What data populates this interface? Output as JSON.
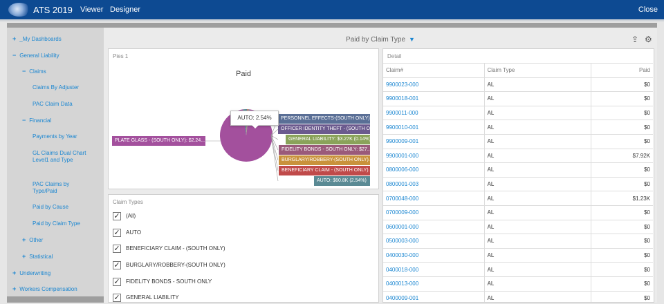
{
  "topbar": {
    "app_title": "ATS 2019",
    "nav_viewer": "Viewer",
    "nav_designer": "Designer",
    "close": "Close"
  },
  "sidebar": {
    "items": [
      {
        "sign": "+",
        "label": "_My Dashboards"
      },
      {
        "sign": "−",
        "label": "General Liability"
      },
      {
        "sign": "−",
        "label": "Claims"
      },
      {
        "sign": "",
        "label": "Claims By Adjuster"
      },
      {
        "sign": "",
        "label": "PAC Claim Data"
      },
      {
        "sign": "−",
        "label": "Financial"
      },
      {
        "sign": "",
        "label": "Payments  by Year"
      },
      {
        "sign": "",
        "label": "GL Claims Dual Chart Level1 and Type"
      },
      {
        "sign": "",
        "label": "PAC Claims by Type/Paid"
      },
      {
        "sign": "",
        "label": "Paid by Cause"
      },
      {
        "sign": "",
        "label": "Paid by Claim Type"
      },
      {
        "sign": "+",
        "label": "Other"
      },
      {
        "sign": "+",
        "label": "Statistical"
      },
      {
        "sign": "+",
        "label": "Underwriting"
      },
      {
        "sign": "+",
        "label": "Workers Compensation"
      }
    ]
  },
  "dashboard": {
    "title": "Paid by Claim Type",
    "filter_icon": "filter-icon",
    "export_icon": "export-icon",
    "settings_icon": "parameters-icon"
  },
  "pie_panel": {
    "caption": "Pies 1",
    "title": "Paid",
    "tooltip": "AUTO: 2.54%",
    "labels": [
      {
        "text": "PERSONNEL EFFECTS-(SOUTH ONLY): ...",
        "color": "#5a6f96"
      },
      {
        "text": "OFFICER IDENTITY THEFT - (SOUTH O...",
        "color": "#6b5a8e"
      },
      {
        "text": "GENERAL LIABILITY: $3.27K (0.14%)",
        "color": "#8aa35a"
      },
      {
        "text": "FIDELITY BONDS - SOUTH ONLY: $27....",
        "color": "#9a5a7a"
      },
      {
        "text": "BURGLARY/ROBBERY-(SOUTH ONLY)...",
        "color": "#c9923c"
      },
      {
        "text": "BENEFICIARY CLAIM - (SOUTH ONLY)...",
        "color": "#c04a4a"
      },
      {
        "text": "AUTO: $60.8K (2.54%)",
        "color": "#5a8a94"
      }
    ],
    "left_label": {
      "text": "PLATE GLASS - (SOUTH ONLY): $2.24...",
      "color": "#a3509d"
    }
  },
  "chart_data": {
    "type": "pie",
    "title": "Paid",
    "slices": [
      {
        "label": "PLATE GLASS - (SOUTH ONLY)",
        "value_text": "$2.24...",
        "percent": 96.0,
        "color": "#a3509d"
      },
      {
        "label": "AUTO",
        "value_text": "$60.8K",
        "percent": 2.54,
        "color": "#5a8a94"
      },
      {
        "label": "BENEFICIARY CLAIM - (SOUTH ONLY)",
        "percent": 0.4,
        "color": "#c04a4a"
      },
      {
        "label": "BURGLARY/ROBBERY-(SOUTH ONLY)",
        "percent": 0.3,
        "color": "#c9923c"
      },
      {
        "label": "FIDELITY BONDS - SOUTH ONLY",
        "value_text": "$27....",
        "percent": 0.25,
        "color": "#9a5a7a"
      },
      {
        "label": "GENERAL LIABILITY",
        "value_text": "$3.27K",
        "percent": 0.14,
        "color": "#8aa35a"
      },
      {
        "label": "OFFICER IDENTITY THEFT - (SOUTH ONLY)",
        "percent": 0.2,
        "color": "#6b5a8e"
      },
      {
        "label": "PERSONNEL EFFECTS-(SOUTH ONLY)",
        "percent": 0.17,
        "color": "#5a6f96"
      }
    ]
  },
  "claim_types": {
    "caption": "Claim Types",
    "items": [
      {
        "label": "(All)",
        "checked": "✓"
      },
      {
        "label": "AUTO",
        "checked": "✓"
      },
      {
        "label": "BENEFICIARY CLAIM - (SOUTH ONLY)",
        "checked": "✓"
      },
      {
        "label": "BURGLARY/ROBBERY-(SOUTH ONLY)",
        "checked": "✓"
      },
      {
        "label": "FIDELITY BONDS - SOUTH ONLY",
        "checked": "✓"
      },
      {
        "label": "GENERAL LIABILITY",
        "checked": "✓"
      }
    ]
  },
  "detail": {
    "caption": "Detail",
    "columns": [
      "Claim#",
      "Claim Type",
      "Paid"
    ],
    "rows": [
      [
        "9900023-000",
        "AL",
        "$0"
      ],
      [
        "9900018-001",
        "AL",
        "$0"
      ],
      [
        "9900011-000",
        "AL",
        "$0"
      ],
      [
        "9900010-001",
        "AL",
        "$0"
      ],
      [
        "9900009-001",
        "AL",
        "$0"
      ],
      [
        "9900001-000",
        "AL",
        "$7.92K"
      ],
      [
        "0800006-000",
        "AL",
        "$0"
      ],
      [
        "0800001-003",
        "AL",
        "$0"
      ],
      [
        "0700048-000",
        "AL",
        "$1.23K"
      ],
      [
        "0700009-000",
        "AL",
        "$0"
      ],
      [
        "0600001-000",
        "AL",
        "$0"
      ],
      [
        "0500003-000",
        "AL",
        "$0"
      ],
      [
        "0400030-000",
        "AL",
        "$0"
      ],
      [
        "0400018-000",
        "AL",
        "$0"
      ],
      [
        "0400013-000",
        "AL",
        "$0"
      ],
      [
        "0400009-001",
        "AL",
        "$0"
      ]
    ]
  }
}
